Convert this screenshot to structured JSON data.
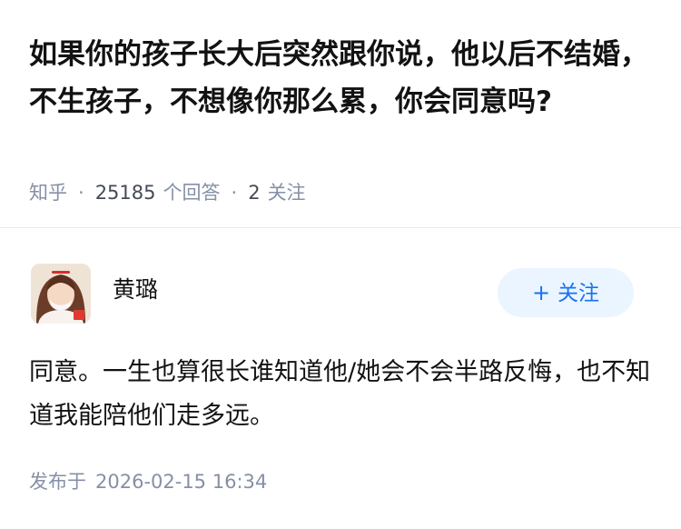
{
  "question": {
    "title": "如果你的孩子长大后突然跟你说，他以后不结婚，不生孩子，不想像你那么累，你会同意吗?",
    "source": "知乎",
    "answer_count": "25185",
    "answer_label": "个回答",
    "follow_count": "2",
    "follow_label": "关注",
    "separator": "·"
  },
  "author": {
    "name": "黄璐",
    "avatar_icon": "avatar-icon"
  },
  "follow_button": {
    "plus": "+",
    "label": "关注"
  },
  "answer": {
    "content": "同意。一生也算很长谁知道他/她会不会半路反悔，也不知道我能陪他们走多远。",
    "published_label": "发布于",
    "published_time": "2026-02-15 16:34"
  },
  "colors": {
    "accent": "#1772f6",
    "button_bg": "#ebf5ff",
    "meta_gray": "#8590a6",
    "text": "#121212"
  }
}
